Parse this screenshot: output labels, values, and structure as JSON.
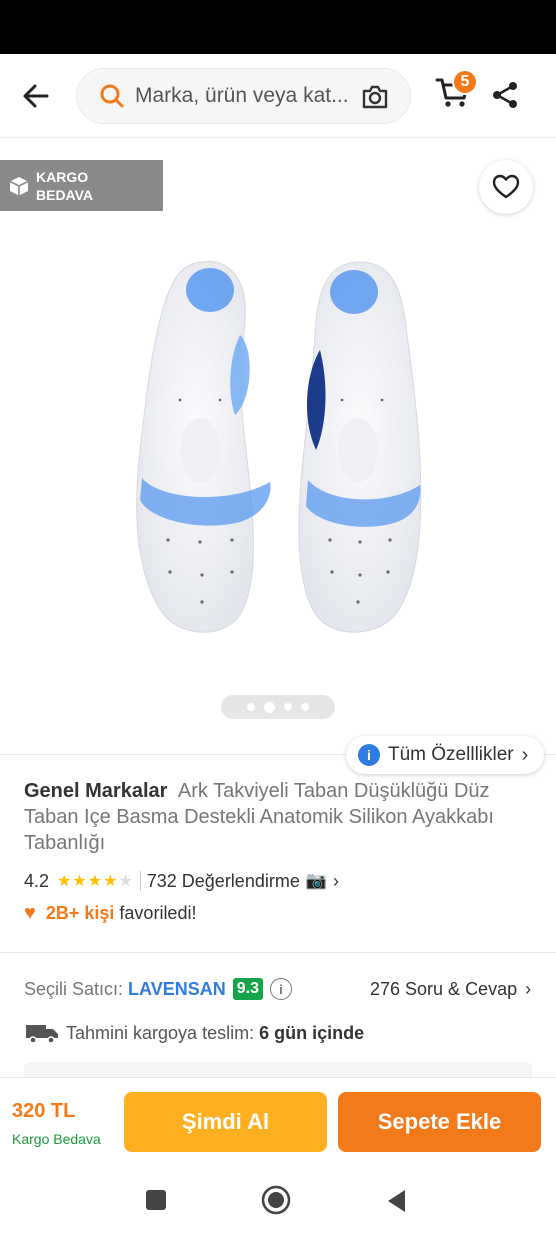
{
  "search": {
    "placeholder": "Marka, ürün veya kat..."
  },
  "header": {
    "cart_count": "5"
  },
  "badge": {
    "line1": "KARGO",
    "line2": "BEDAVA"
  },
  "gallery": {
    "slides": 4,
    "active_index": 1
  },
  "features_button": {
    "icon": "i",
    "label": "Tüm Özelllikler"
  },
  "product": {
    "brand": "Genel Markalar",
    "name": "Ark Takviyeli Taban Düşüklüğü Düz Taban Içe Basma Destekli Anatomik Silikon Ayakkabı Tabanlığı",
    "rating": "4.2",
    "rating_value": 4.2,
    "reviews": "732 Değerlendirme",
    "fav_count": "2B+ kişi",
    "fav_text": "favoriledi!"
  },
  "seller": {
    "label": "Seçili Satıcı:",
    "name": "LAVENSAN",
    "score": "9.3",
    "qa": "276 Soru & Cevap"
  },
  "delivery": {
    "label": "Tahmini kargoya teslim:",
    "days": "6 gün içinde"
  },
  "bottom": {
    "price": "320 TL",
    "shipping": "Kargo Bedava",
    "buy_now": "Şimdi Al",
    "add_to_cart": "Sepete Ekle"
  },
  "colors": {
    "accent": "#f27a1a",
    "buy_now": "#ffb020",
    "link_blue": "#2f7de1",
    "score_green": "#16a34a",
    "badge_gray": "#8a8a8a"
  },
  "icons": {
    "back": "arrow-left-icon",
    "search": "search-icon",
    "camera": "camera-icon",
    "cart": "cart-icon",
    "share": "share-icon",
    "favorite": "heart-outline-icon",
    "box": "box-icon",
    "truck": "truck-icon"
  }
}
